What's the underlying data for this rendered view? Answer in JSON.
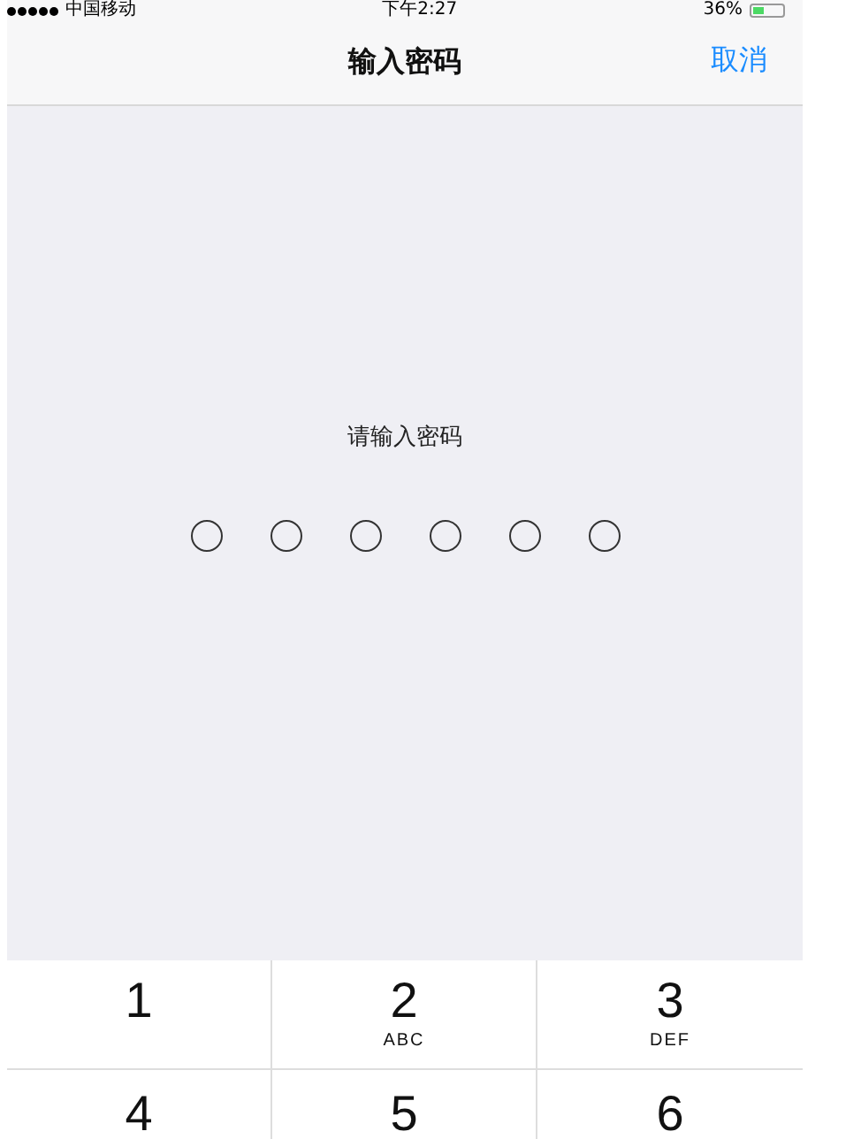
{
  "status_bar": {
    "carrier": "中国移动",
    "time": "下午2:27",
    "battery": "36%"
  },
  "nav_bar": {
    "title": "输入密码",
    "action": "取消"
  },
  "prompt": "请输入密码",
  "passcode_dots": [
    {
      "filled": false
    },
    {
      "filled": false
    },
    {
      "filled": false
    },
    {
      "filled": false
    },
    {
      "filled": false
    },
    {
      "filled": false
    }
  ],
  "keypad": [
    {
      "digit": "1"
    },
    {
      "digit": "2",
      "letters": "ABC"
    },
    {
      "digit": "3",
      "letters": "DEF"
    },
    {
      "digit": "4"
    },
    {
      "digit": "5"
    },
    {
      "digit": "6"
    }
  ]
}
